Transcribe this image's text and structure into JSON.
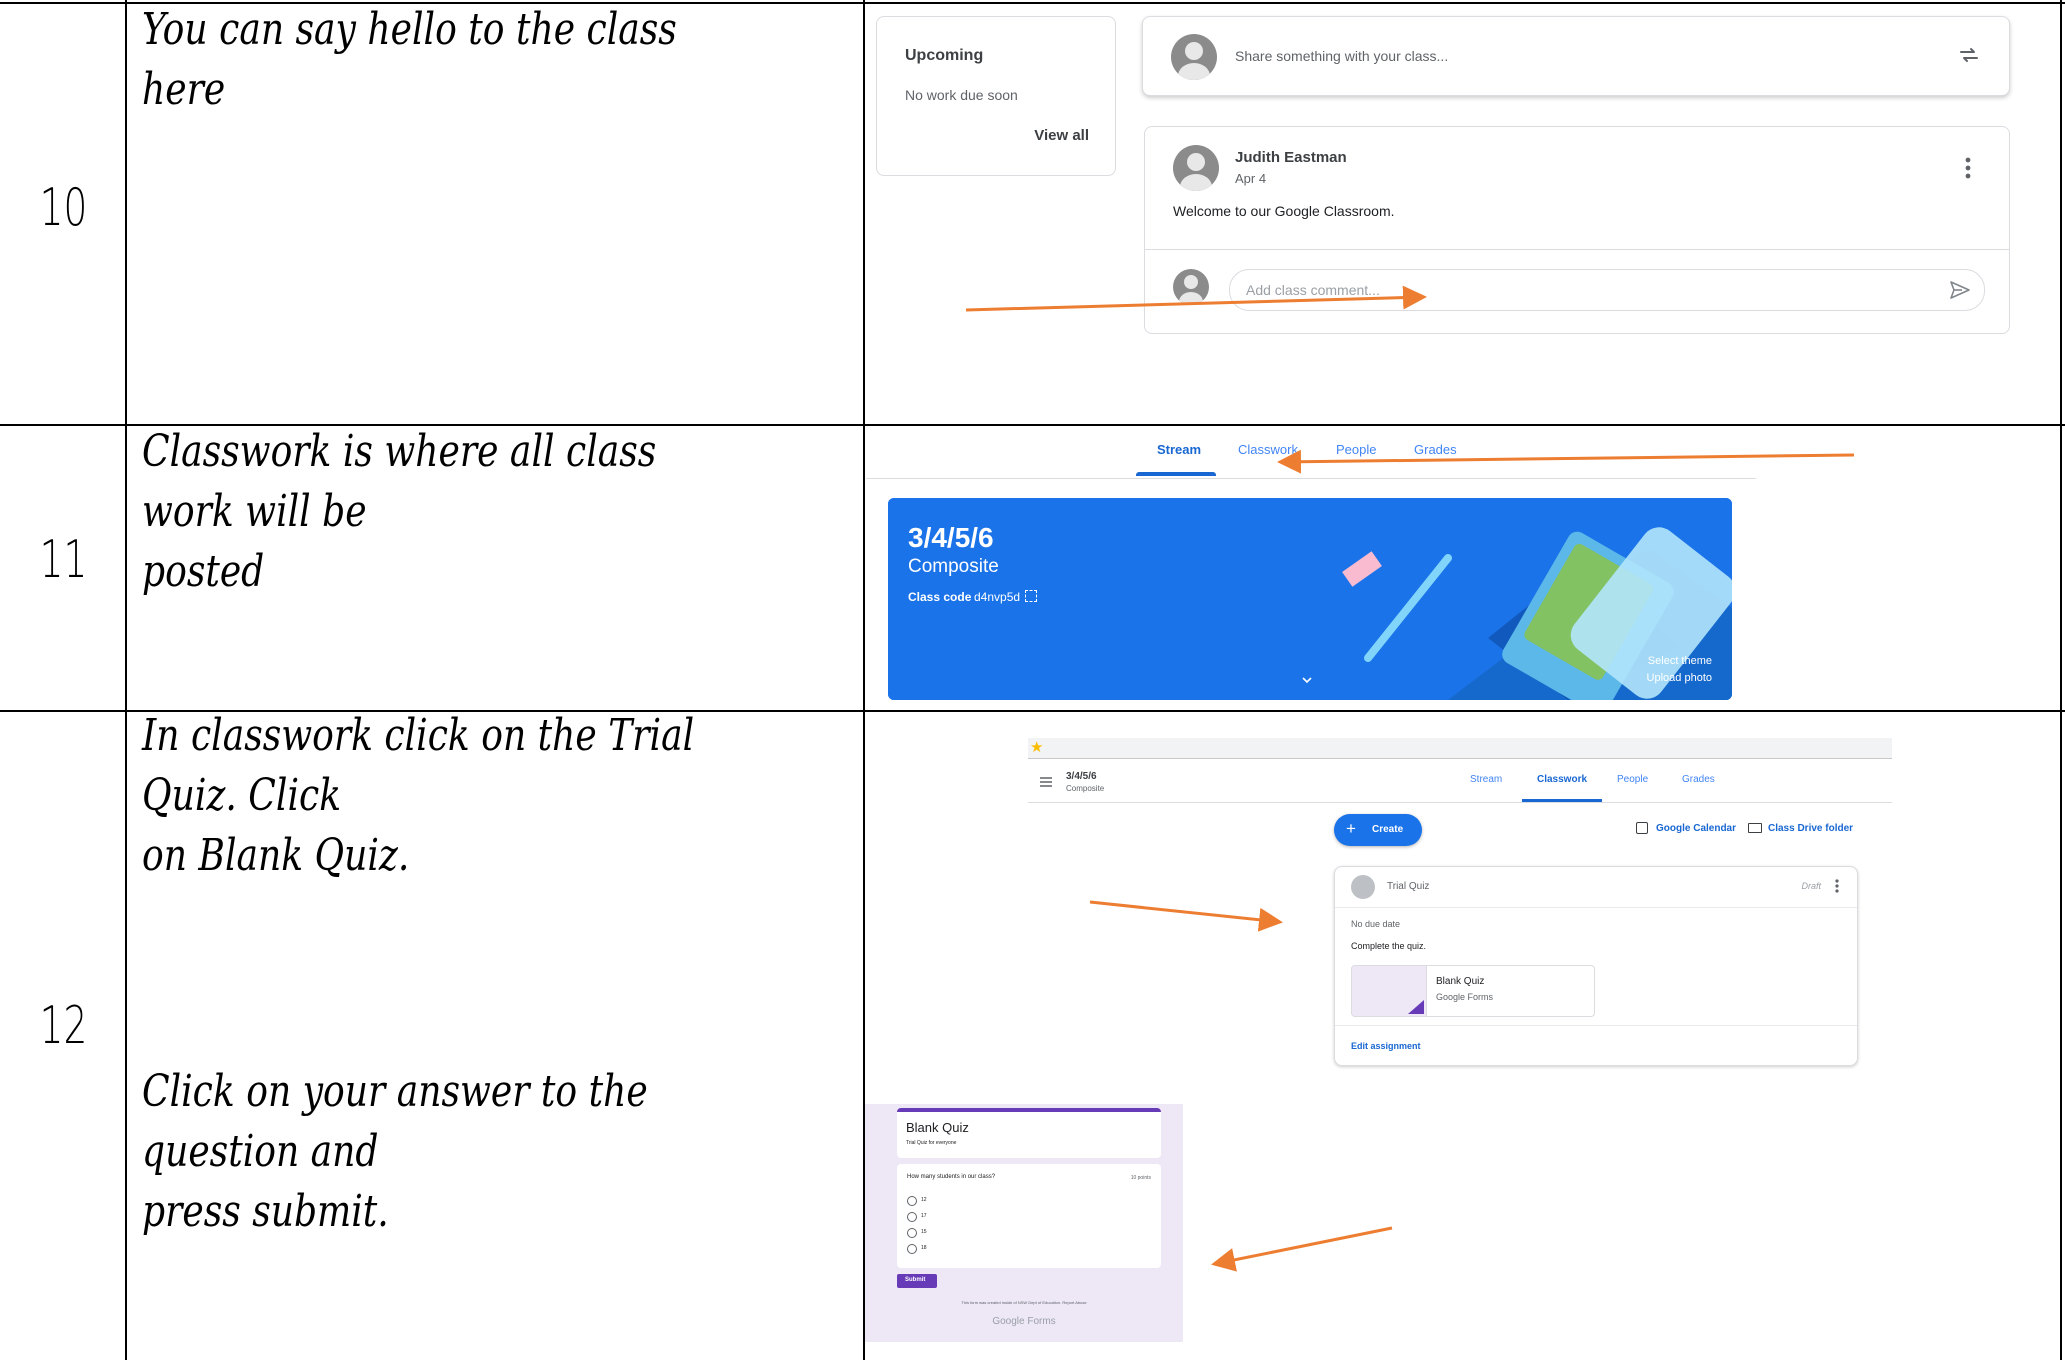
{
  "rows": [
    {
      "num": "10",
      "instruction": "You can say hello to the class here"
    },
    {
      "num": "11",
      "instruction": "Classwork is where all class work will be\nposted"
    },
    {
      "num": "12",
      "instruction": "In classwork click on the Trial Quiz. Click\non Blank Quiz.",
      "instruction2": "Click on your answer to the question and\npress submit."
    }
  ],
  "stream": {
    "upcoming_title": "Upcoming",
    "upcoming_empty": "No work due soon",
    "view_all": "View all",
    "share_placeholder": "Share something with your class...",
    "post_author": "Judith Eastman",
    "post_date": "Apr 4",
    "post_body": "Welcome to our Google Classroom.",
    "comment_placeholder": "Add class comment..."
  },
  "tabs": [
    "Stream",
    "Classwork",
    "People",
    "Grades"
  ],
  "banner": {
    "title": "3/4/5/6",
    "subtitle": "Composite",
    "code_label": "Class code",
    "code_value": "d4nvp5d",
    "select_theme": "Select theme",
    "upload_photo": "Upload photo",
    "color": "#1a73e8"
  },
  "classwork": {
    "class_name": "3/4/5/6",
    "class_sub": "Composite",
    "create_label": "Create",
    "calendar_label": "Google Calendar",
    "drive_label": "Class Drive folder",
    "assignment_title": "Trial Quiz",
    "assignment_status": "Draft",
    "due": "No due date",
    "instructions": "Complete the quiz.",
    "attachment_title": "Blank Quiz",
    "attachment_type": "Google Forms",
    "edit_label": "Edit assignment"
  },
  "quiz": {
    "title": "Blank Quiz",
    "desc": "Trial Quiz for everyone",
    "question": "How many students in our class?",
    "points": "10 points",
    "options": [
      "12",
      "17",
      "15",
      "18"
    ],
    "submit": "Submit",
    "footer": "This form was created inside of NSW Dept of Education. Report Abuse",
    "brand": "Google Forms"
  },
  "accent": "#1967d2",
  "arrow_color": "#ed7d31",
  "forms_purple": "#673ab7"
}
